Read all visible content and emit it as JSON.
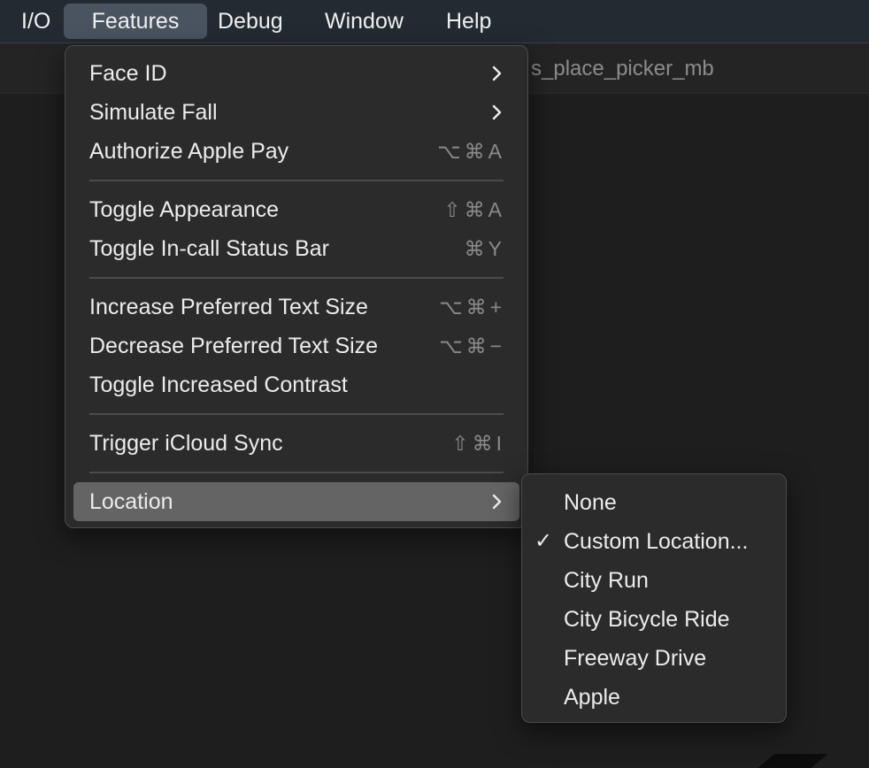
{
  "menubar": {
    "items": [
      {
        "label": "I/O"
      },
      {
        "label": "Features"
      },
      {
        "label": "Debug"
      },
      {
        "label": "Window"
      },
      {
        "label": "Help"
      }
    ]
  },
  "background": {
    "title": "s_place_picker_mb"
  },
  "features_menu": {
    "items": [
      {
        "label": "Face ID",
        "shortcut": "",
        "submenu": true
      },
      {
        "label": "Simulate Fall",
        "shortcut": "",
        "submenu": true
      },
      {
        "label": "Authorize Apple Pay",
        "shortcut": "⌥⌘A"
      },
      {
        "label": "Toggle Appearance",
        "shortcut": "⇧⌘A"
      },
      {
        "label": "Toggle In-call Status Bar",
        "shortcut": "⌘Y"
      },
      {
        "label": "Increase Preferred Text Size",
        "shortcut": "⌥⌘+"
      },
      {
        "label": "Decrease Preferred Text Size",
        "shortcut": "⌥⌘−"
      },
      {
        "label": "Toggle Increased Contrast",
        "shortcut": ""
      },
      {
        "label": "Trigger iCloud Sync",
        "shortcut": "⇧⌘I"
      },
      {
        "label": "Location",
        "shortcut": "",
        "submenu": true,
        "highlighted": true
      }
    ]
  },
  "location_menu": {
    "checkmark": "✓",
    "items": [
      {
        "label": "None",
        "checked": false
      },
      {
        "label": "Custom Location...",
        "checked": true
      },
      {
        "label": "City Run",
        "checked": false
      },
      {
        "label": "City Bicycle Ride",
        "checked": false
      },
      {
        "label": "Freeway Drive",
        "checked": false
      },
      {
        "label": "Apple",
        "checked": false
      }
    ]
  }
}
